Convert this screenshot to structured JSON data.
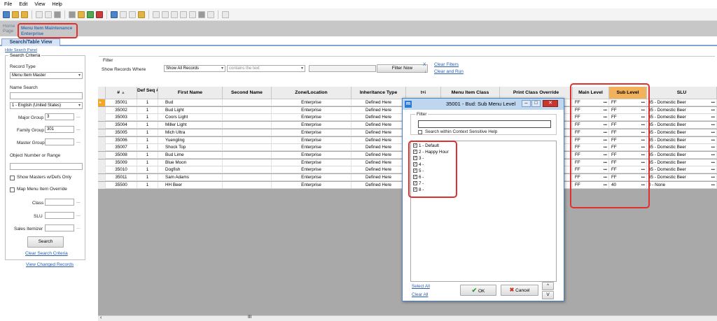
{
  "menu": [
    "File",
    "Edit",
    "View",
    "Help"
  ],
  "breadcrumb": {
    "home": "Home Page",
    "current_line1": "Menu Item Maintenance",
    "current_line2": "Enterprise"
  },
  "tab": "Search/Table View",
  "hide_search_panel": "Hide Search Panel",
  "search": {
    "legend": "Search Criteria",
    "record_type_label": "Record Type",
    "record_type_value": "Menu Item Master",
    "name_search_label": "Name Search",
    "language_value": "1 - English (United States)",
    "major_group_label": "Major Group",
    "major_group_value": "3",
    "family_group_label": "Family Group",
    "family_group_value": "301",
    "master_group_label": "Master Group",
    "object_number_label": "Object Number or Range",
    "show_masters_label": "Show Masters w/Defs Only",
    "map_override_label": "Map Menu Item Override",
    "class_label": "Class",
    "slu_label": "SLU",
    "sales_itemizer_label": "Sales Itemizer",
    "search_button": "Search",
    "clear_criteria": "Clear Search Criteria",
    "view_changed": "View Changed Records"
  },
  "filter": {
    "legend": "Filter",
    "show_records_label": "Show Records Where",
    "field_value": "Show All Records",
    "op_value": "contains the text",
    "filter_now": "Filter Now",
    "clear_x": "X",
    "clear_filters": "Clear Filters",
    "clear_and_run": "Clear and Run"
  },
  "columns": {
    "num": "#",
    "defseq": "Def Seq #",
    "first": "First Name",
    "second": "Second Name",
    "zone": "Zone/Location",
    "inherit": "Inheritance Type",
    "tl": "t+i",
    "mic": "Menu Item Class",
    "print": "Print Class Override",
    "main": "Main Level",
    "sub": "Sub Level",
    "slu": "SLU"
  },
  "rows": [
    {
      "num": "35001",
      "def": "1",
      "first": "Bud",
      "zone": "Enterprise",
      "inherit": "Defined Here",
      "main": "FF",
      "sub": "FF",
      "slu": "35 - Domestic Beer"
    },
    {
      "num": "35002",
      "def": "1",
      "first": "Bud Light",
      "zone": "Enterprise",
      "inherit": "Defined Here",
      "main": "FF",
      "sub": "FF",
      "slu": "35 - Domestic Beer"
    },
    {
      "num": "35003",
      "def": "1",
      "first": "Coors Light",
      "zone": "Enterprise",
      "inherit": "Defined Here",
      "main": "FF",
      "sub": "FF",
      "slu": "35 - Domestic Beer"
    },
    {
      "num": "35004",
      "def": "1",
      "first": "Miller Light",
      "zone": "Enterprise",
      "inherit": "Defined Here",
      "main": "FF",
      "sub": "FF",
      "slu": "35 - Domestic Beer"
    },
    {
      "num": "35005",
      "def": "1",
      "first": "Mich Ultra",
      "zone": "Enterprise",
      "inherit": "Defined Here",
      "main": "FF",
      "sub": "FF",
      "slu": "35 - Domestic Beer"
    },
    {
      "num": "35006",
      "def": "1",
      "first": "Yuengling",
      "zone": "Enterprise",
      "inherit": "Defined Here",
      "main": "FF",
      "sub": "FF",
      "slu": "35 - Domestic Beer"
    },
    {
      "num": "35007",
      "def": "1",
      "first": "Shock Top",
      "zone": "Enterprise",
      "inherit": "Defined Here",
      "main": "FF",
      "sub": "FF",
      "slu": "35 - Domestic Beer"
    },
    {
      "num": "35008",
      "def": "1",
      "first": "Bud Lime",
      "zone": "Enterprise",
      "inherit": "Defined Here",
      "main": "FF",
      "sub": "FF",
      "slu": "35 - Domestic Beer"
    },
    {
      "num": "35009",
      "def": "1",
      "first": "Blue Moon",
      "zone": "Enterprise",
      "inherit": "Defined Here",
      "main": "FF",
      "sub": "FF",
      "slu": "35 - Domestic Beer"
    },
    {
      "num": "35010",
      "def": "1",
      "first": "Dogfish",
      "zone": "Enterprise",
      "inherit": "Defined Here",
      "main": "FF",
      "sub": "FF",
      "slu": "35 - Domestic Beer"
    },
    {
      "num": "35011",
      "def": "1",
      "first": "Sam Adams",
      "zone": "Enterprise",
      "inherit": "Defined Here",
      "main": "FF",
      "sub": "FF",
      "slu": "35 - Domestic Beer"
    },
    {
      "num": "35500",
      "def": "1",
      "first": "HH Beer",
      "zone": "Enterprise",
      "inherit": "Defined Here",
      "main": "FF",
      "sub": "40",
      "slu": "0 - None"
    }
  ],
  "dialog": {
    "title": "35001 - Bud: Sub Menu Level",
    "icon_letter": "m",
    "filter_legend": "Filter",
    "context_label": "Search within Context Sensitive Help",
    "items": [
      "1 - Default",
      "2 - Happy Hour",
      "3 -",
      "4 -",
      "5 -",
      "6 -",
      "7 -",
      "8 -"
    ],
    "select_all": "Select All",
    "clear_all": "Clear All",
    "ok": "OK",
    "cancel": "Cancel",
    "up": "^",
    "down": "V"
  },
  "scroll_label": "III"
}
